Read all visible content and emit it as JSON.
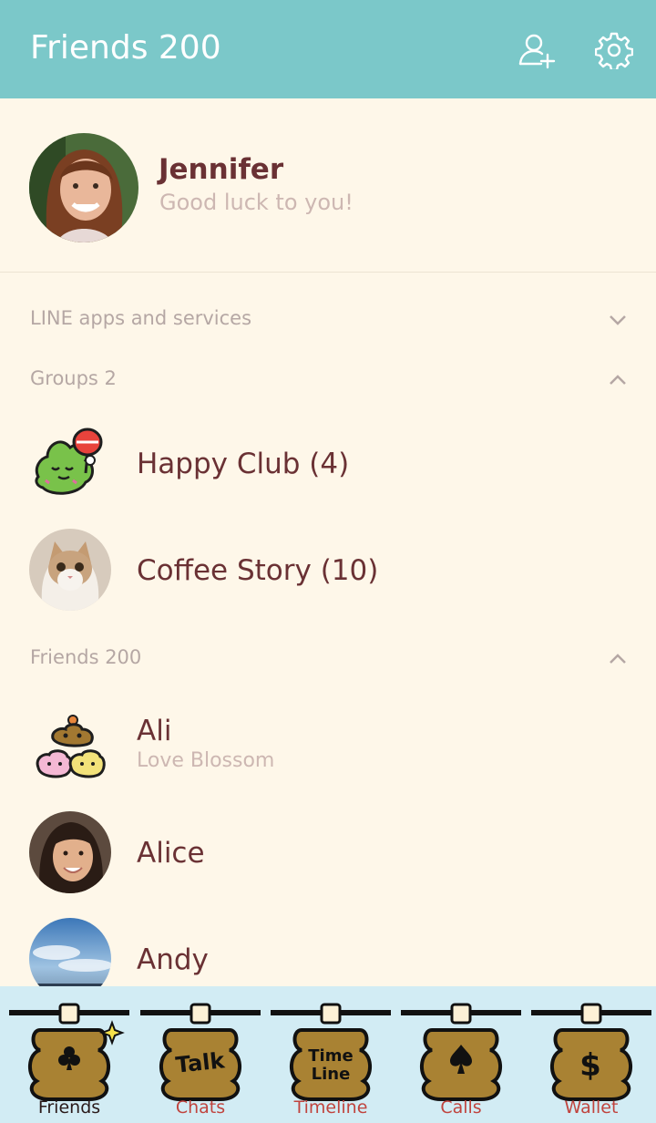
{
  "header": {
    "title": "Friends 200"
  },
  "profile": {
    "name": "Jennifer",
    "status": "Good luck to you!"
  },
  "sections": {
    "services": {
      "label": "LINE apps and services"
    },
    "groups": {
      "label": "Groups 2"
    },
    "friends": {
      "label": "Friends 200"
    }
  },
  "groups": [
    {
      "name": "Happy Club (4)"
    },
    {
      "name": "Coffee Story (10)"
    }
  ],
  "friends": [
    {
      "name": "Ali",
      "status": "Love Blossom"
    },
    {
      "name": "Alice"
    },
    {
      "name": "Andy"
    }
  ],
  "tabs": [
    {
      "label": "Friends",
      "icon_text": ""
    },
    {
      "label": "Chats",
      "icon_text": "Talk"
    },
    {
      "label": "Timeline",
      "icon_text": "Time Line"
    },
    {
      "label": "Calls",
      "icon_text": ""
    },
    {
      "label": "Wallet",
      "icon_text": ""
    }
  ],
  "colors": {
    "header": "#7BC8C9",
    "background": "#FEF7E9",
    "name_text": "#6A3134",
    "tab_active": "#2A1A1A",
    "tab_inactive": "#C0443E"
  }
}
